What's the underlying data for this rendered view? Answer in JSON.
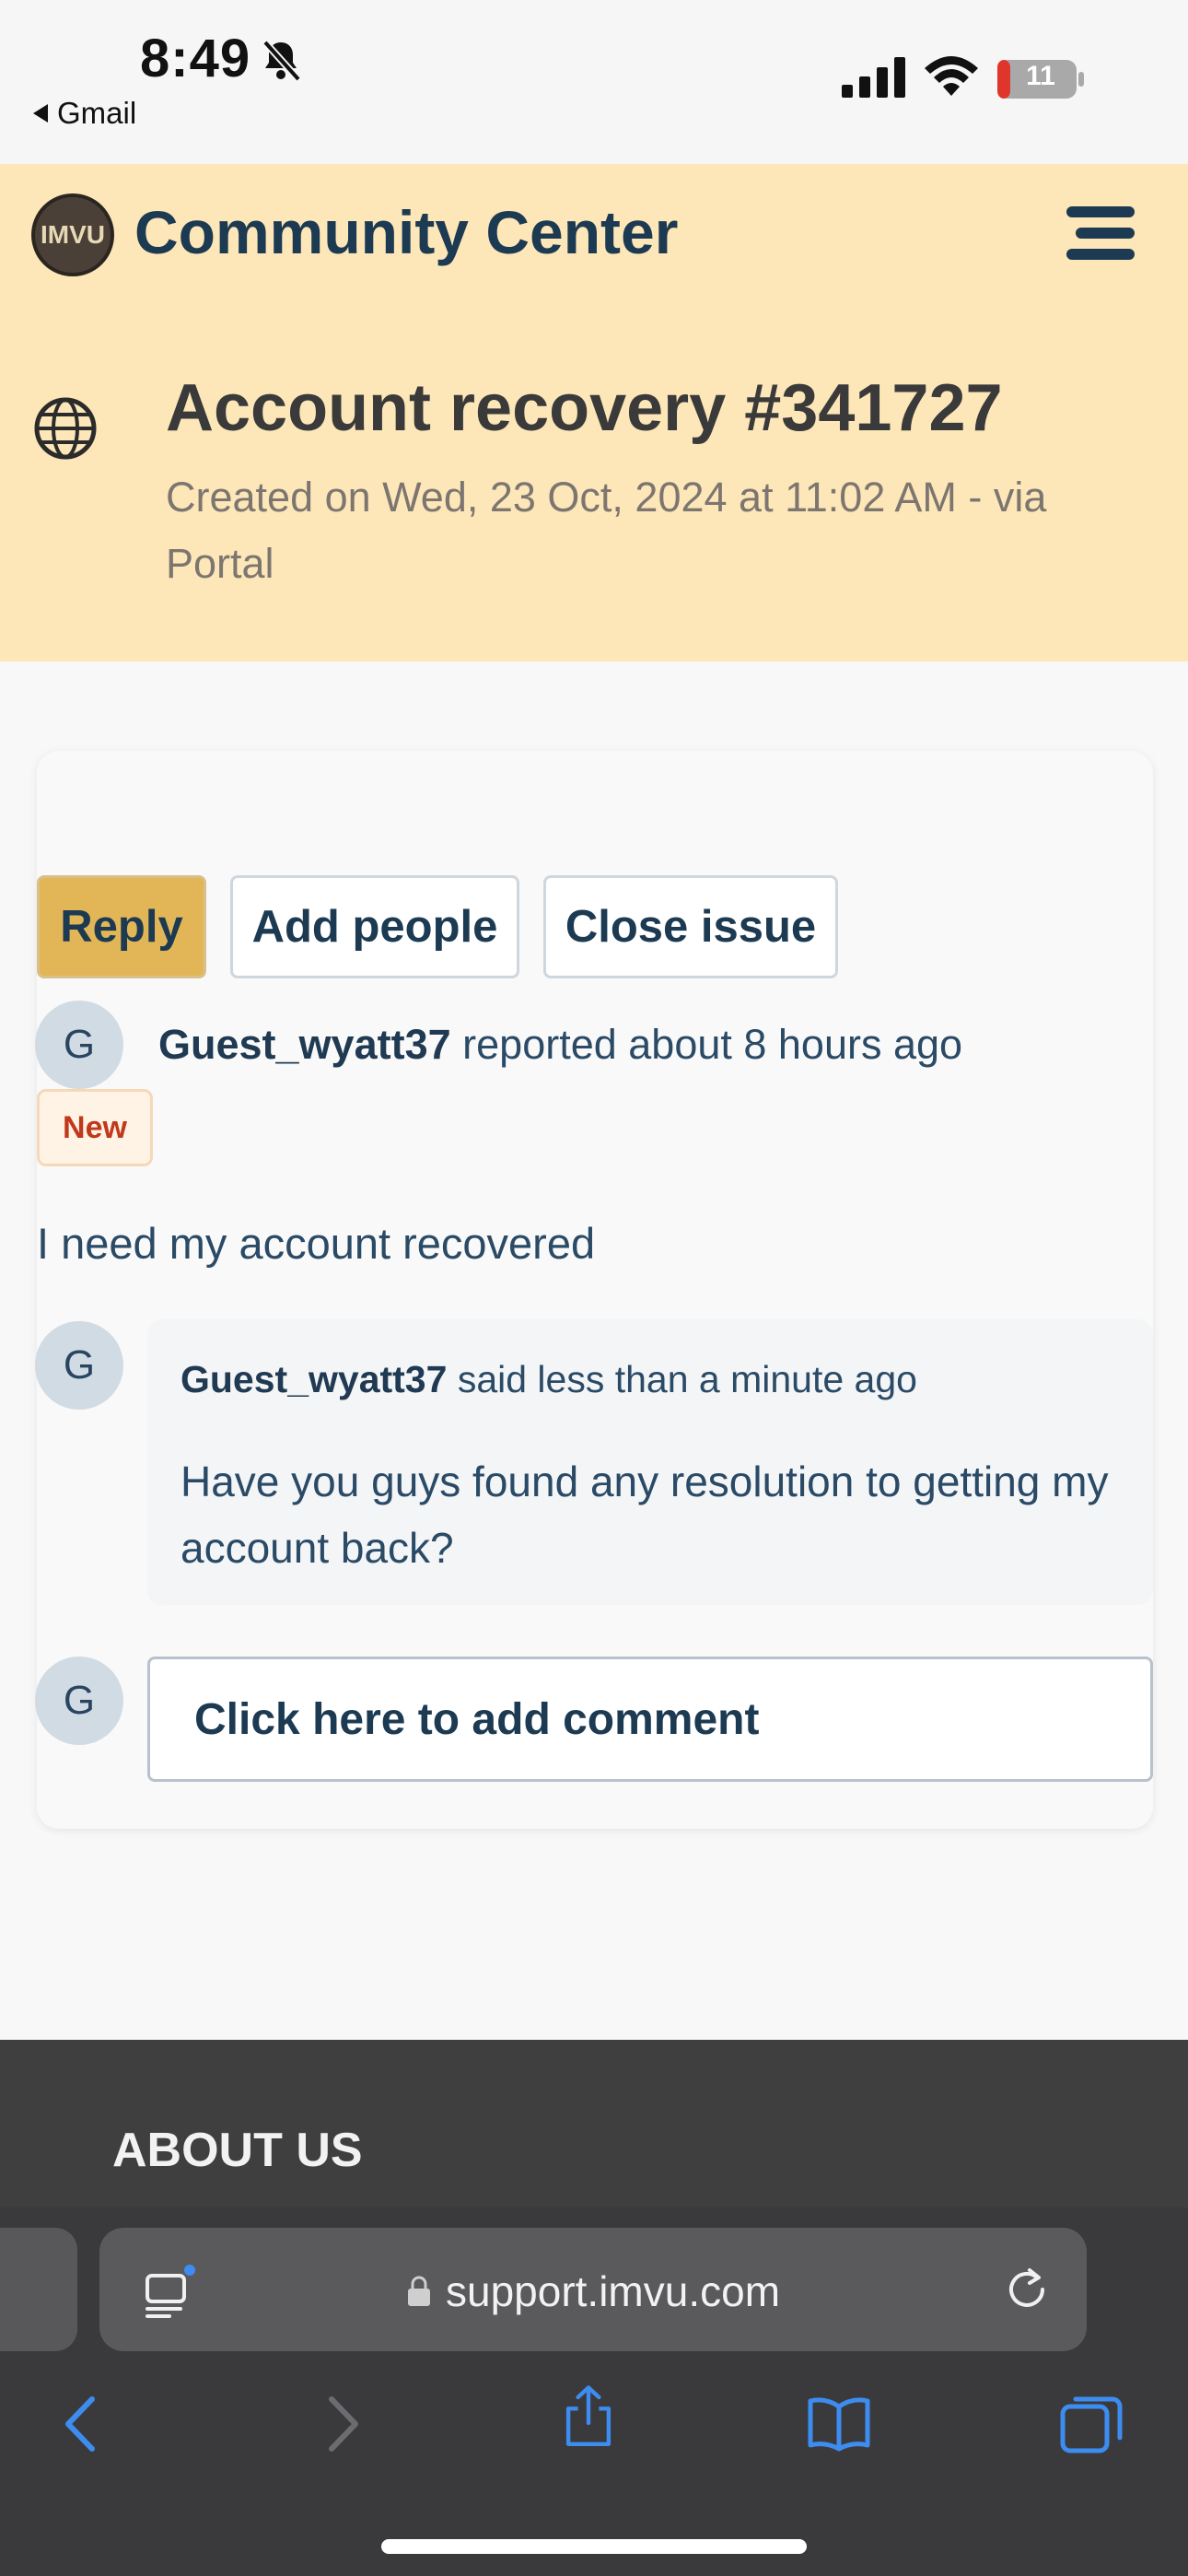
{
  "status_bar": {
    "time": "8:49",
    "back_app": "Gmail",
    "battery": "11",
    "icons": [
      "bell-slash-icon",
      "signal-icon",
      "wifi-icon",
      "battery-icon"
    ]
  },
  "header": {
    "logo_text": "IMVU",
    "site_title": "Community Center",
    "menu_icon": "hamburger-icon"
  },
  "ticket": {
    "title": "Account recovery #341727",
    "meta": "Created on Wed, 23 Oct, 2024 at 11:02 AM - via Portal",
    "icon": "globe-icon"
  },
  "actions": {
    "reply": "Reply",
    "add_people": "Add people",
    "close_issue": "Close issue"
  },
  "report": {
    "avatar": "G",
    "user": "Guest_wyatt37",
    "text": "reported about 8 hours ago",
    "badge": "New",
    "body": "I need my account recovered"
  },
  "comment": {
    "avatar": "G",
    "user": "Guest_wyatt37",
    "time": "said less than a minute ago",
    "text": "Have you guys found any resolution to getting my account back?"
  },
  "add_comment": {
    "avatar": "G",
    "label": "Click here to add comment"
  },
  "footer": {
    "heading": "ABOUT US"
  },
  "browser": {
    "url": "support.imvu.com",
    "colors": {
      "accent": "#3d8cf0",
      "chrome": "#3a3a3c"
    }
  },
  "colors": {
    "header_bg": "#fde7b8",
    "reply_button": "#e2b656",
    "badge_text": "#c0391b",
    "title_text": "#1c3a52"
  }
}
